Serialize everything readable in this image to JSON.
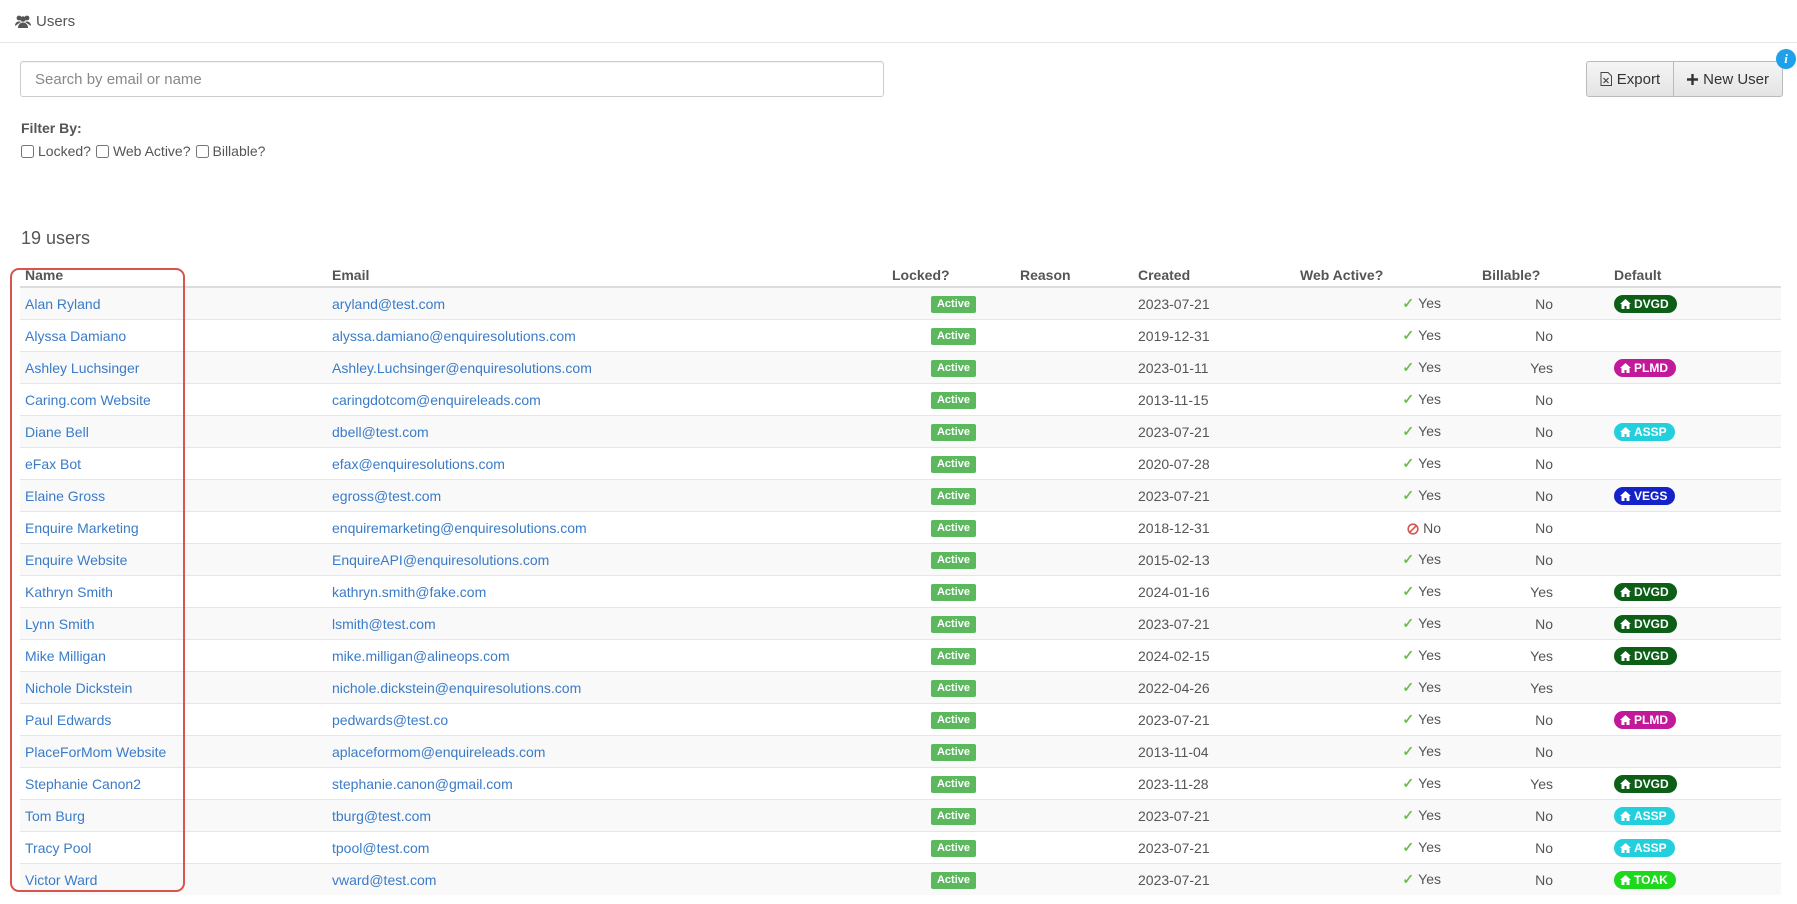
{
  "header": {
    "title": "Users",
    "icon": "users-icon"
  },
  "search": {
    "placeholder": "Search by email or name",
    "value": ""
  },
  "toolbar": {
    "export_label": "Export",
    "new_user_label": "New User",
    "info_label": "i"
  },
  "filters": {
    "title": "Filter By:",
    "options": [
      "Locked?",
      "Web Active?",
      "Billable?"
    ]
  },
  "summary": {
    "count_text": "19 users"
  },
  "table": {
    "columns": [
      "Name",
      "Email",
      "Locked?",
      "Reason",
      "Created",
      "Web Active?",
      "Billable?",
      "Default"
    ],
    "rows": [
      {
        "name": "Alan Ryland",
        "email": "aryland@test.com",
        "locked": "Active",
        "reason": "",
        "created": "2023-07-21",
        "web": "Yes",
        "billable": "No",
        "default": "DVGD",
        "color": "#0d5e16"
      },
      {
        "name": "Alyssa Damiano",
        "email": "alyssa.damiano@enquiresolutions.com",
        "locked": "Active",
        "reason": "",
        "created": "2019-12-31",
        "web": "Yes",
        "billable": "No",
        "default": "",
        "color": ""
      },
      {
        "name": "Ashley Luchsinger",
        "email": "Ashley.Luchsinger@enquiresolutions.com",
        "locked": "Active",
        "reason": "",
        "created": "2023-01-11",
        "web": "Yes",
        "billable": "Yes",
        "default": "PLMD",
        "color": "#c2189a"
      },
      {
        "name": "Caring.com Website",
        "email": "caringdotcom@enquireleads.com",
        "locked": "Active",
        "reason": "",
        "created": "2013-11-15",
        "web": "Yes",
        "billable": "No",
        "default": "",
        "color": ""
      },
      {
        "name": "Diane Bell",
        "email": "dbell@test.com",
        "locked": "Active",
        "reason": "",
        "created": "2023-07-21",
        "web": "Yes",
        "billable": "No",
        "default": "ASSP",
        "color": "#24cfdc"
      },
      {
        "name": "eFax Bot",
        "email": "efax@enquiresolutions.com",
        "locked": "Active",
        "reason": "",
        "created": "2020-07-28",
        "web": "Yes",
        "billable": "No",
        "default": "",
        "color": ""
      },
      {
        "name": "Elaine Gross",
        "email": "egross@test.com",
        "locked": "Active",
        "reason": "",
        "created": "2023-07-21",
        "web": "Yes",
        "billable": "No",
        "default": "VEGS",
        "color": "#1521c9"
      },
      {
        "name": "Enquire Marketing",
        "email": "enquiremarketing@enquiresolutions.com",
        "locked": "Active",
        "reason": "",
        "created": "2018-12-31",
        "web": "No",
        "billable": "No",
        "default": "",
        "color": ""
      },
      {
        "name": "Enquire Website",
        "email": "EnquireAPI@enquiresolutions.com",
        "locked": "Active",
        "reason": "",
        "created": "2015-02-13",
        "web": "Yes",
        "billable": "No",
        "default": "",
        "color": ""
      },
      {
        "name": "Kathryn Smith",
        "email": "kathryn.smith@fake.com",
        "locked": "Active",
        "reason": "",
        "created": "2024-01-16",
        "web": "Yes",
        "billable": "Yes",
        "default": "DVGD",
        "color": "#0d5e16"
      },
      {
        "name": "Lynn Smith",
        "email": "lsmith@test.com",
        "locked": "Active",
        "reason": "",
        "created": "2023-07-21",
        "web": "Yes",
        "billable": "No",
        "default": "DVGD",
        "color": "#0d5e16"
      },
      {
        "name": "Mike Milligan",
        "email": "mike.milligan@alineops.com",
        "locked": "Active",
        "reason": "",
        "created": "2024-02-15",
        "web": "Yes",
        "billable": "Yes",
        "default": "DVGD",
        "color": "#0d5e16"
      },
      {
        "name": "Nichole Dickstein",
        "email": "nichole.dickstein@enquiresolutions.com",
        "locked": "Active",
        "reason": "",
        "created": "2022-04-26",
        "web": "Yes",
        "billable": "Yes",
        "default": "",
        "color": ""
      },
      {
        "name": "Paul Edwards",
        "email": "pedwards@test.co",
        "locked": "Active",
        "reason": "",
        "created": "2023-07-21",
        "web": "Yes",
        "billable": "No",
        "default": "PLMD",
        "color": "#c2189a"
      },
      {
        "name": "PlaceForMom Website",
        "email": "aplaceformom@enquireleads.com",
        "locked": "Active",
        "reason": "",
        "created": "2013-11-04",
        "web": "Yes",
        "billable": "No",
        "default": "",
        "color": ""
      },
      {
        "name": "Stephanie Canon2",
        "email": "stephanie.canon@gmail.com",
        "locked": "Active",
        "reason": "",
        "created": "2023-11-28",
        "web": "Yes",
        "billable": "Yes",
        "default": "DVGD",
        "color": "#0d5e16"
      },
      {
        "name": "Tom Burg",
        "email": "tburg@test.com",
        "locked": "Active",
        "reason": "",
        "created": "2023-07-21",
        "web": "Yes",
        "billable": "No",
        "default": "ASSP",
        "color": "#24cfdc"
      },
      {
        "name": "Tracy Pool",
        "email": "tpool@test.com",
        "locked": "Active",
        "reason": "",
        "created": "2023-07-21",
        "web": "Yes",
        "billable": "No",
        "default": "ASSP",
        "color": "#24cfdc"
      },
      {
        "name": "Victor Ward",
        "email": "vward@test.com",
        "locked": "Active",
        "reason": "",
        "created": "2023-07-21",
        "web": "Yes",
        "billable": "No",
        "default": "TOAK",
        "color": "#1ed81e"
      }
    ]
  }
}
